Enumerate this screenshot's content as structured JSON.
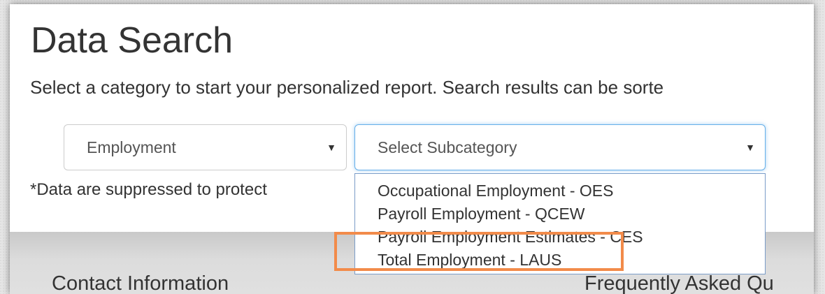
{
  "page": {
    "title": "Data Search",
    "intro": "Select a category to start your personalized report. Search results can be sorte",
    "note": "*Data are suppressed to protect"
  },
  "filters": {
    "category": {
      "selected": "Employment"
    },
    "subcategory": {
      "placeholder": "Select Subcategory",
      "options": [
        "Occupational Employment - OES",
        "Payroll Employment - QCEW",
        "Payroll Employment Estimates - CES",
        "Total Employment - LAUS"
      ],
      "highlighted_option": "Total Employment - LAUS"
    }
  },
  "footer": {
    "contact": "Contact Information",
    "faq": "Frequently Asked Qu"
  },
  "colors": {
    "highlight_outline": "#f28b4a",
    "focus_border": "#66afe9"
  }
}
